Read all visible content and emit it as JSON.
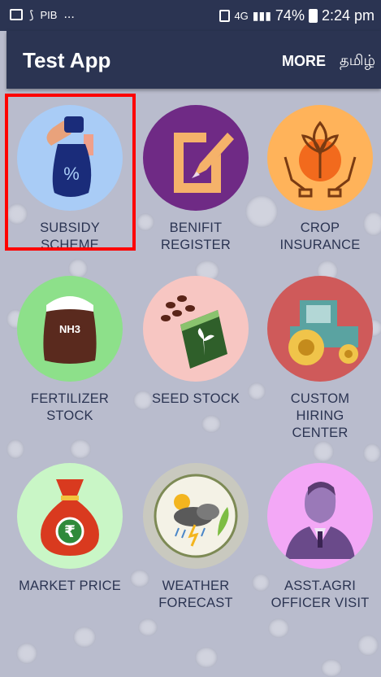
{
  "status_bar": {
    "left_app": "PIB",
    "left_dots": "...",
    "network": "4G",
    "battery": "74%",
    "time": "2:24 pm"
  },
  "app_bar": {
    "title": "Test App",
    "more": "MORE",
    "language": "தமிழ்"
  },
  "tiles": [
    {
      "label1": "SUBSIDY",
      "label2": "SCHEME",
      "label3": "",
      "icon": "money-bag-hand-icon",
      "color": "#a9ccf6"
    },
    {
      "label1": "BENIFIT",
      "label2": "REGISTER",
      "label3": "",
      "icon": "document-pencil-icon",
      "color": "#6f2a85"
    },
    {
      "label1": "CROP",
      "label2": "INSURANCE",
      "label3": "",
      "icon": "hands-plant-icon",
      "color": "#ffb35a"
    },
    {
      "label1": "FERTILIZER",
      "label2": "STOCK",
      "label3": "",
      "icon": "fertilizer-sack-icon",
      "color": "#8de08a",
      "sack_text": "NH3"
    },
    {
      "label1": "SEED STOCK",
      "label2": "",
      "label3": "",
      "icon": "seed-packet-icon",
      "color": "#f7c6c2"
    },
    {
      "label1": "CUSTOM",
      "label2": "HIRING",
      "label3": "CENTER",
      "icon": "tractor-icon",
      "color": "#cf5a5a"
    },
    {
      "label1": "MARKET PRICE",
      "label2": "",
      "label3": "",
      "icon": "rupee-bag-icon",
      "color": "#c9f6c6",
      "symbol": "₹"
    },
    {
      "label1": "WEATHER",
      "label2": "FORECAST",
      "label3": "",
      "icon": "weather-icon",
      "color": "#c9c9bf"
    },
    {
      "label1": "ASST.AGRI",
      "label2": "OFFICER VISIT",
      "label3": "",
      "icon": "officer-icon",
      "color": "#f3a8f6"
    }
  ],
  "selected_tile": "SUBSIDY SCHEME"
}
